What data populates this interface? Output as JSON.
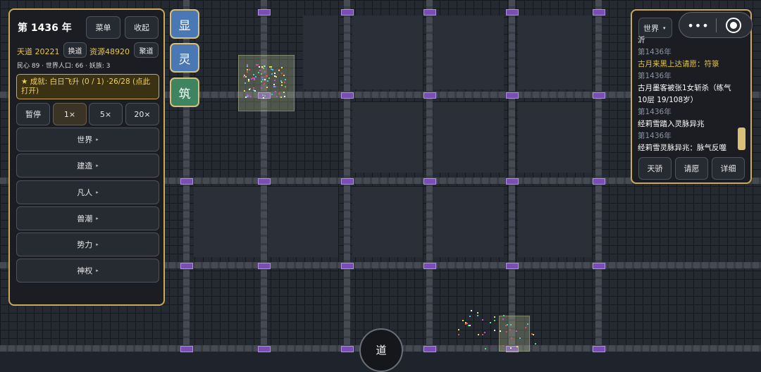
{
  "left_panel": {
    "year": "第 1436 年",
    "menu_label": "菜单",
    "collapse_label": "收起",
    "tiandao_label": "天道",
    "tiandao_value": "20221",
    "huandao_label": "换道",
    "ziyuan_label": "资源",
    "ziyuan_value": "48920",
    "jidao_label": "聚道",
    "status_line": "民心 89 · 世界人口: 66 · 妖族: 3",
    "achievement": "★ 成就: 白日飞升 (0 / 1) ·26/28 (点此打开)",
    "speeds": [
      "暂停",
      "1×",
      "5×",
      "20×"
    ],
    "active_speed": "1×",
    "nav_items": [
      "世界",
      "建造",
      "凡人",
      "兽潮",
      "势力",
      "神权"
    ],
    "nav_arrow": "▸"
  },
  "side_buttons": [
    "显",
    "灵",
    "筑"
  ],
  "right_panel": {
    "world_select": "世界",
    "caret": "▾",
    "more_icon": "•••",
    "log": [
      {
        "year": "",
        "text": "沂",
        "style": "white"
      },
      {
        "year": "第1436年",
        "text": "古月来黑上达请愿：符箓",
        "style": "gold"
      },
      {
        "year": "第1436年",
        "text": "古月墨客被张1女斩杀（练气10层 19/108岁）",
        "style": "white"
      },
      {
        "year": "第1436年",
        "text": "经莉雪踏入灵脉异兆",
        "style": "white"
      },
      {
        "year": "第1436年",
        "text": "经莉雪灵脉异兆：脉气反噬",
        "style": "white"
      }
    ],
    "scroll_position": 0.95,
    "buttons": [
      "天骄",
      "请愿",
      "详细"
    ]
  },
  "dao_button": "道",
  "colors": {
    "panel_border": "#c9a95a",
    "gold_text": "#e6c84a",
    "side_blue": "#4a78b4",
    "side_green": "#3f8461",
    "gate_purple": "#7a4fb5"
  }
}
